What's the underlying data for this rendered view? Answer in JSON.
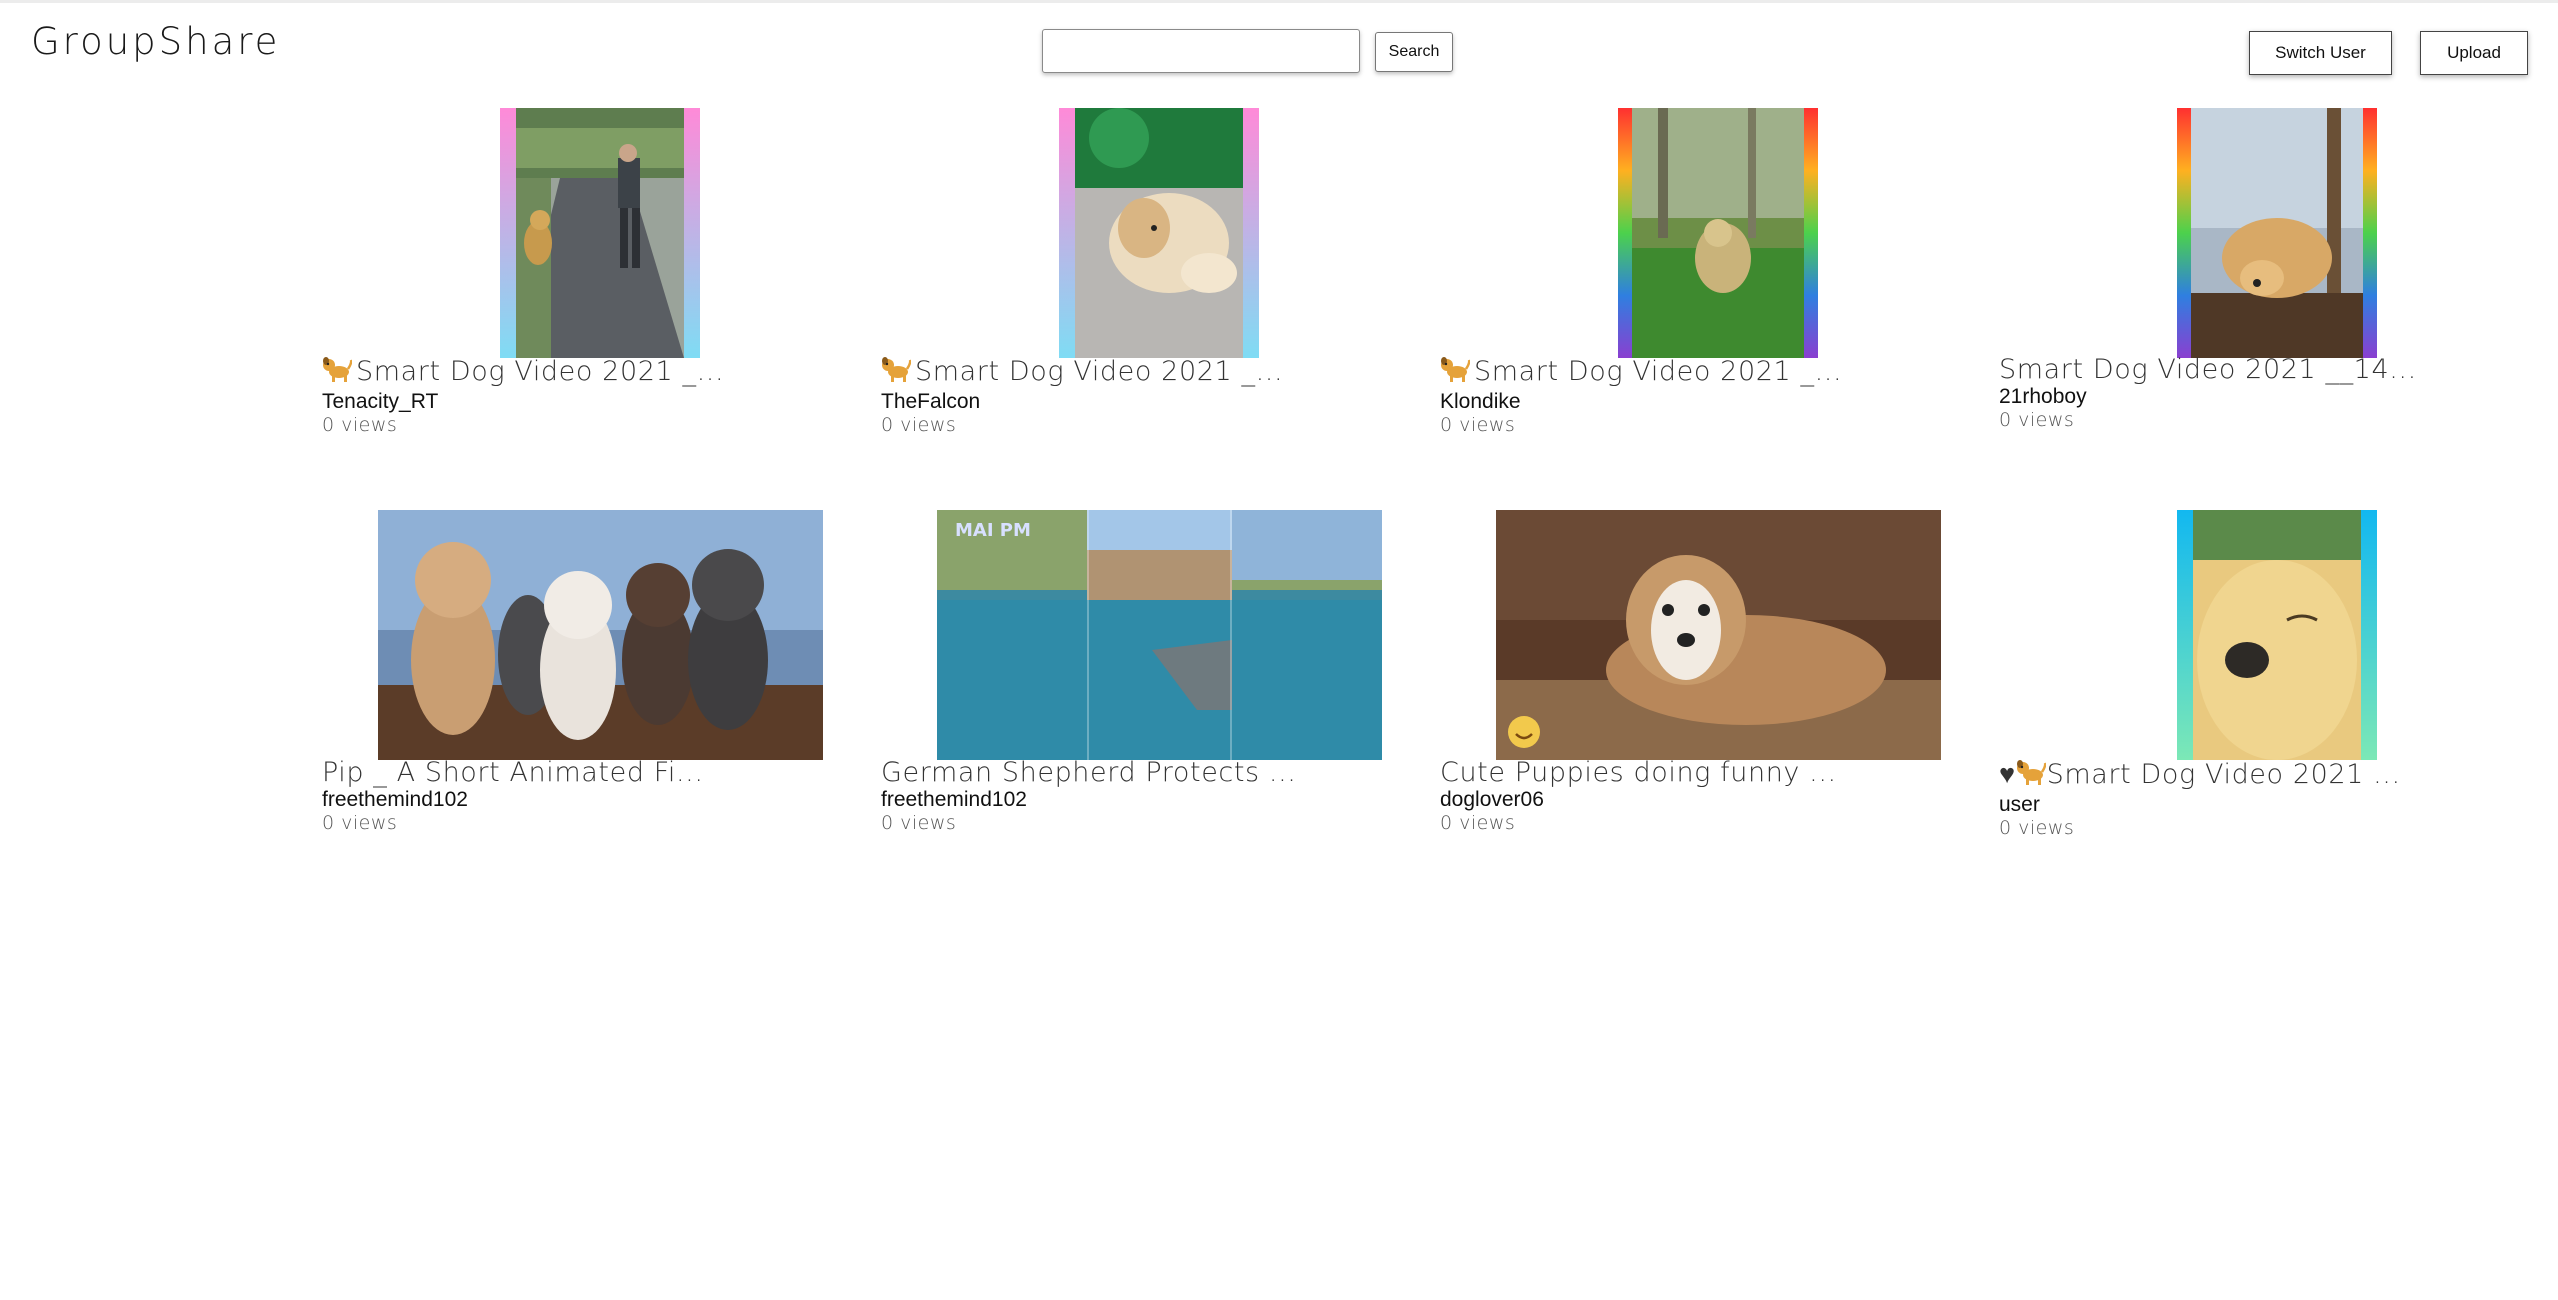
{
  "app": {
    "title": "GroupShare"
  },
  "header": {
    "search_placeholder": "",
    "search_value": "",
    "search_label": "Search",
    "switch_user_label": "Switch User",
    "upload_label": "Upload"
  },
  "videos": [
    {
      "title": "Smart Dog Video 2021 _...",
      "prefix_icon": "dog-icon",
      "author": "Tenacity_RT",
      "views": "0 views"
    },
    {
      "title": "Smart Dog Video 2021 _...",
      "prefix_icon": "dog-icon",
      "author": "TheFalcon",
      "views": "0 views"
    },
    {
      "title": "Smart Dog Video 2021 _...",
      "prefix_icon": "dog-icon",
      "author": "Klondike",
      "views": "0 views"
    },
    {
      "title": "Smart Dog Video 2021 __14...",
      "prefix_icon": "",
      "author": "21rhoboy",
      "views": "0 views"
    },
    {
      "title": "Pip _ A Short Animated Fi...",
      "prefix_icon": "",
      "author": "freethemind102",
      "views": "0 views"
    },
    {
      "title": "German Shepherd Protects ...",
      "prefix_icon": "",
      "author": "freethemind102",
      "views": "0 views"
    },
    {
      "title": "Cute Puppies doing funny ...",
      "prefix_icon": "",
      "author": "doglover06",
      "views": "0 views"
    },
    {
      "title": "Smart Dog Video 2021 ...",
      "prefix_icon": "heart-dog-icon",
      "title_prefix_text": "♥",
      "author": "user",
      "views": "0 views"
    }
  ],
  "thumbnail_overlays": {
    "video_6_caption": "MAI PM"
  }
}
